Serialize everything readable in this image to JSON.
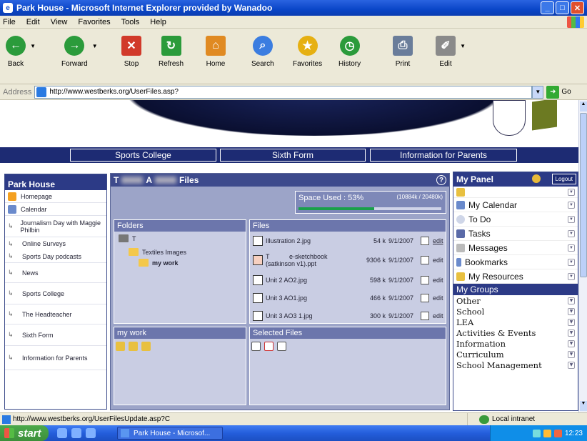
{
  "window": {
    "title": "Park House - Microsoft Internet Explorer provided by Wanadoo",
    "ie_icon": "ie-icon",
    "buttons": [
      "_",
      "□",
      "✕"
    ]
  },
  "menu": [
    "File",
    "Edit",
    "View",
    "Favorites",
    "Tools",
    "Help"
  ],
  "toolbar": {
    "buttons": [
      {
        "label": "Back",
        "color": "#2b9b3b",
        "glyph": "←"
      },
      {
        "label": "Forward",
        "color": "#2b9b3b",
        "glyph": "→"
      },
      {
        "label": "Stop",
        "color": "#d13a2a",
        "glyph": "✕"
      },
      {
        "label": "Refresh",
        "color": "#2b9b3b",
        "glyph": "↻"
      },
      {
        "label": "Home",
        "color": "#e08a22",
        "glyph": "⌂"
      },
      {
        "label": "Search",
        "color": "#3b7de0",
        "glyph": "⌕"
      },
      {
        "label": "Favorites",
        "color": "#e6b012",
        "glyph": "★"
      },
      {
        "label": "History",
        "color": "#2b9b3b",
        "glyph": "◷"
      },
      {
        "label": "Print",
        "color": "#6a7d9a",
        "glyph": "⎙"
      },
      {
        "label": "Edit",
        "color": "#8a8a8a",
        "glyph": "✐"
      }
    ]
  },
  "address": {
    "label": "Address",
    "url": "http://www.westberks.org/UserFiles.asp?",
    "go": "Go"
  },
  "nav_tabs": [
    "Sports College",
    "Sixth Form",
    "Information for Parents"
  ],
  "left": {
    "title": "Park House",
    "items": [
      {
        "label": "Homepage",
        "icon": "homepage-icon"
      },
      {
        "label": "Calendar",
        "icon": "calendar-icon"
      },
      {
        "label": "Journalism Day with Maggie Philbin",
        "icon": "arrow-icon"
      },
      {
        "label": "Online Surveys",
        "icon": "arrow-icon"
      },
      {
        "label": "Sports Day podcasts",
        "icon": "arrow-icon"
      },
      {
        "label": "News",
        "icon": "arrow-icon"
      },
      {
        "label": "Sports College",
        "icon": "arrow-icon"
      },
      {
        "label": "The Headteacher",
        "icon": "arrow-icon"
      },
      {
        "label": "Sixth Form",
        "icon": "arrow-icon"
      },
      {
        "label": "Information for Parents",
        "icon": "arrow-icon"
      }
    ]
  },
  "main": {
    "title_a": "T",
    "title_b": "A",
    "title_c": "Files",
    "space": {
      "label": "Space Used : 53%",
      "detail": "(10884k / 20480k)",
      "percent": 53
    },
    "folders": {
      "title": "Folders",
      "root": "T",
      "items": [
        "Textiles Images",
        "my work"
      ]
    },
    "files": {
      "title": "Files",
      "rows": [
        {
          "name": "Illustration 2.jpg",
          "size": "54 k",
          "date": "9/1/2007",
          "action": "edit"
        },
        {
          "name": "T           e-sketchbook (satkinson v1).ppt",
          "size": "9306 k",
          "date": "9/1/2007",
          "action": "edit"
        },
        {
          "name": "Unit 2 AO2.jpg",
          "size": "598 k",
          "date": "9/1/2007",
          "action": "edit"
        },
        {
          "name": "Unit 3 AO1.jpg",
          "size": "466 k",
          "date": "9/1/2007",
          "action": "edit"
        },
        {
          "name": "Unit 3 AO3 1.jpg",
          "size": "300 k",
          "date": "9/1/2007",
          "action": "edit"
        }
      ]
    },
    "mywork": {
      "title": "my work"
    },
    "selected": {
      "title": "Selected Files"
    }
  },
  "right": {
    "title": "My Panel",
    "logout": "Logout",
    "items": [
      {
        "label": "",
        "icon": "notes-icon"
      },
      {
        "label": "My Calendar",
        "icon": "calendar-icon"
      },
      {
        "label": "To Do",
        "icon": "todo-icon"
      },
      {
        "label": "Tasks",
        "icon": "tasks-icon"
      },
      {
        "label": "Messages",
        "icon": "messages-icon"
      },
      {
        "label": "Bookmarks",
        "icon": "bookmarks-icon"
      },
      {
        "label": "My Resources",
        "icon": "resources-icon"
      }
    ],
    "groups_title": "My Groups",
    "groups": [
      "Other",
      "School",
      "LEA",
      "Activities & Events",
      "Information",
      "Curriculum",
      "School Management"
    ]
  },
  "status": {
    "url": "http://www.westberks.org/UserFilesUpdate.asp?C",
    "zone": "Local intranet"
  },
  "taskbar": {
    "start": "start",
    "task": "Park House - Microsof...",
    "time": "12:23"
  }
}
